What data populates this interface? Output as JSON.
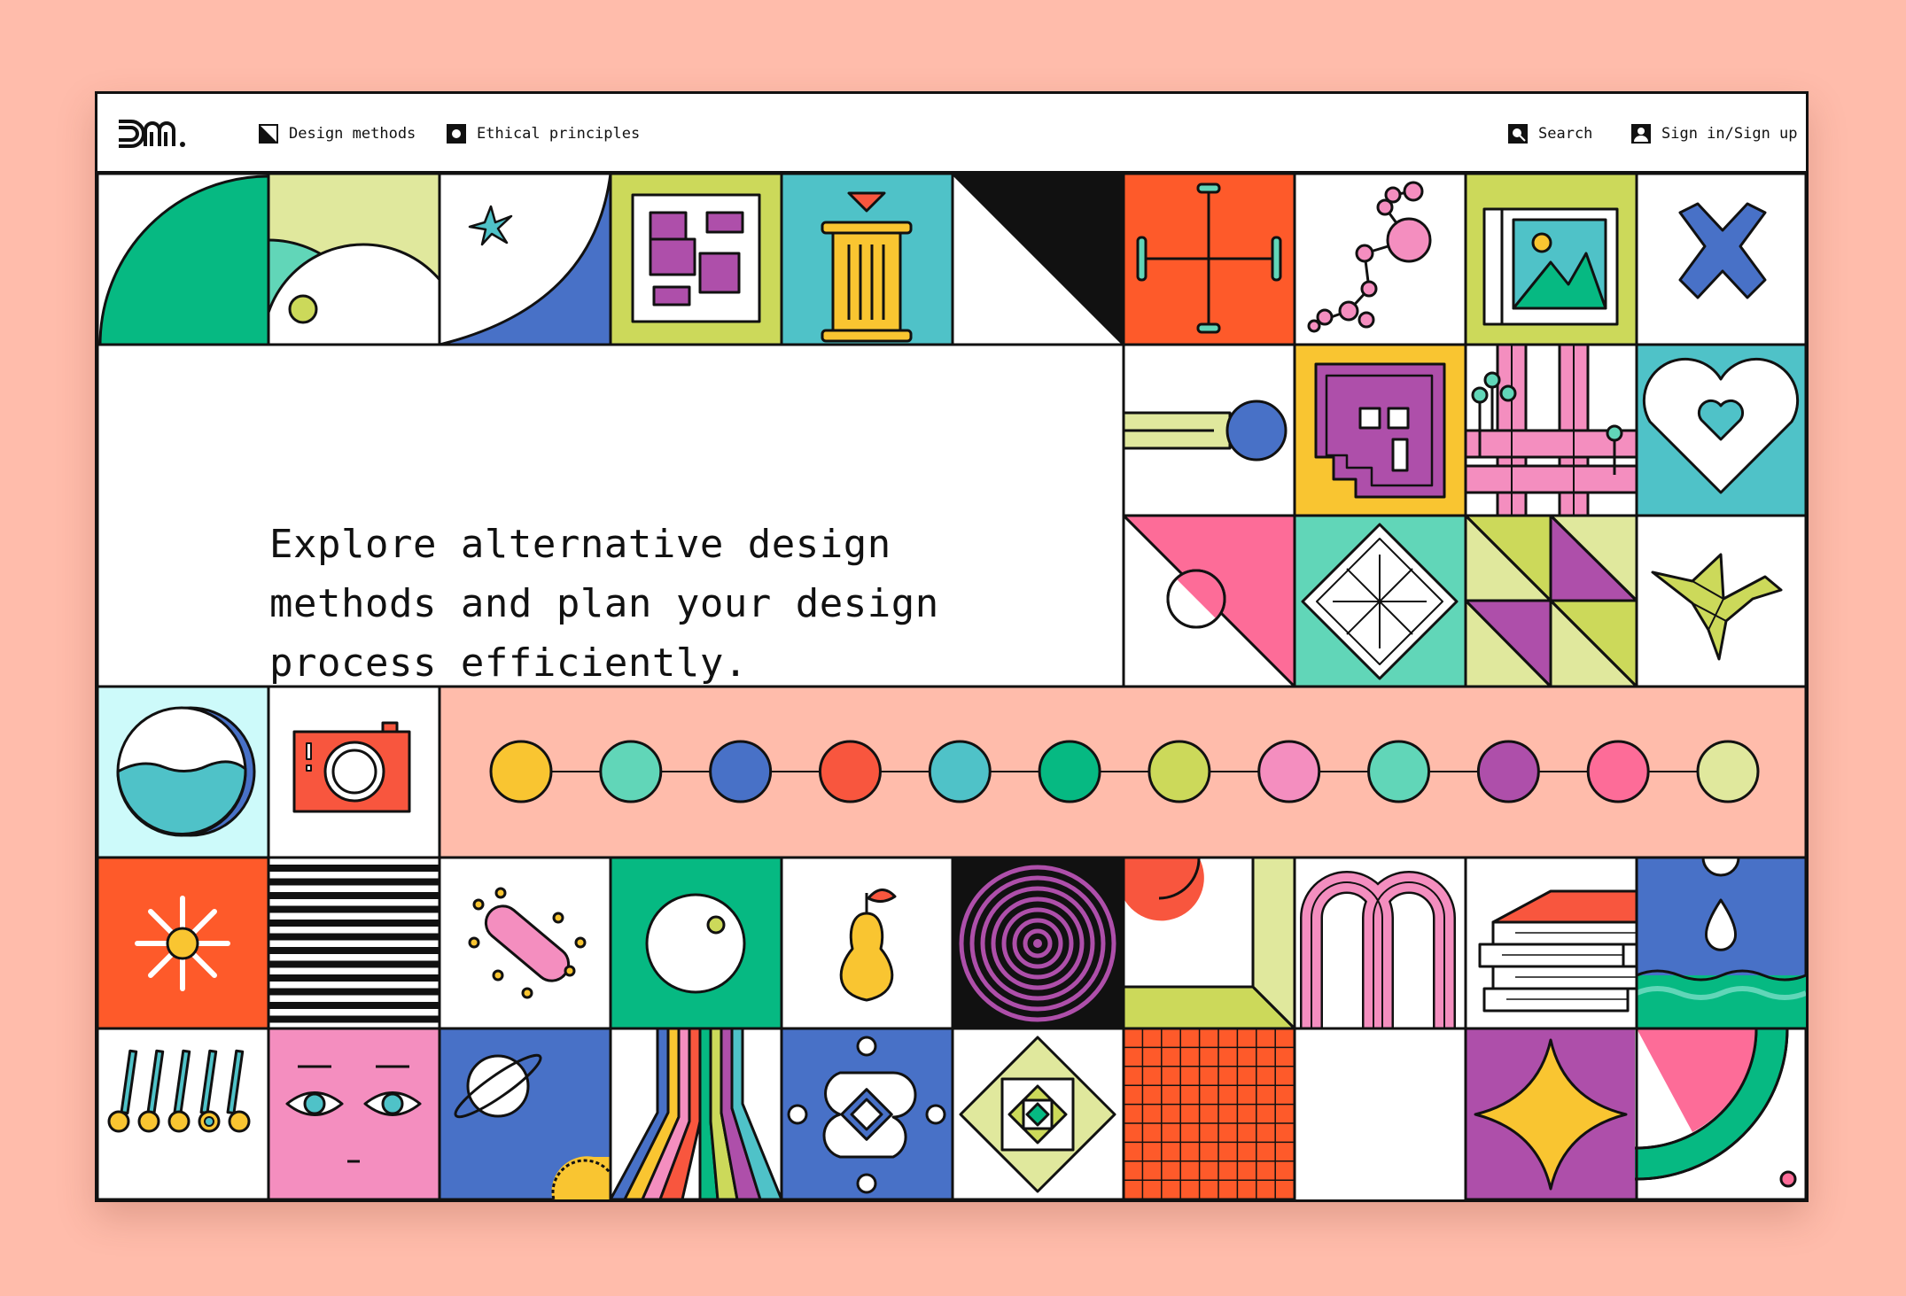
{
  "nav": {
    "logo_text": "Dm.",
    "items": [
      {
        "label": "Design methods",
        "icon": "diagonal-square-icon"
      },
      {
        "label": "Ethical principles",
        "icon": "circle-square-icon"
      }
    ],
    "search_label": "Search",
    "signin_label": "Sign in/Sign up"
  },
  "hero": {
    "headline_line1": "Explore alternative design",
    "headline_line2": "methods and plan your design",
    "headline_line3": "process efficiently."
  },
  "timeline": {
    "colors": [
      "#f9c531",
      "#61d6b8",
      "#4871c7",
      "#f8563e",
      "#4fc2c8",
      "#06b982",
      "#ccd95a",
      "#f48ebf",
      "#61d6b8",
      "#ae4faa",
      "#fd6c98",
      "#e0e89d"
    ]
  },
  "palette": {
    "background": "#ffbcab",
    "green": "#06b982",
    "mint": "#61d6b8",
    "lime": "#e0e89d",
    "olive": "#ccd95a",
    "blue": "#4871c7",
    "teal": "#4fc2c8",
    "orange": "#fe5a2a",
    "red": "#f8563e",
    "pink": "#f48ebf",
    "hotpink": "#fd6c98",
    "purple": "#ae4faa",
    "yellow": "#f9c531"
  }
}
